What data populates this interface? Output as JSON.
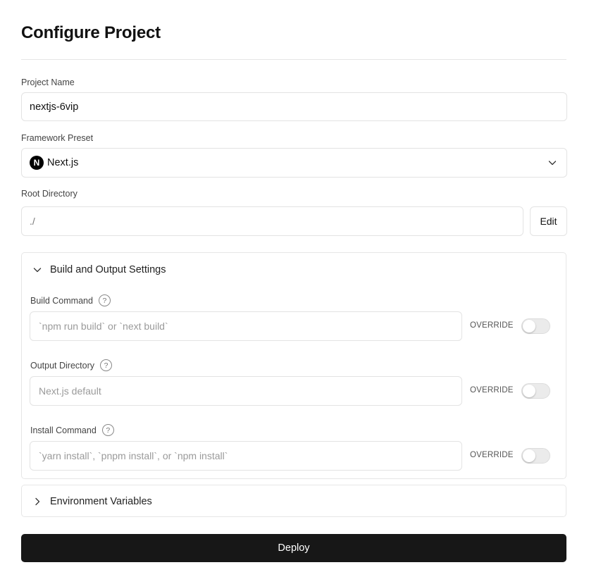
{
  "page": {
    "title": "Configure Project"
  },
  "project_name": {
    "label": "Project Name",
    "value": "nextjs-6vip"
  },
  "framework": {
    "label": "Framework Preset",
    "logo_letter": "N",
    "value": "Next.js",
    "icon": "chevron-down-icon"
  },
  "root_directory": {
    "label": "Root Directory",
    "value": "./",
    "edit_label": "Edit"
  },
  "build_settings": {
    "title": "Build and Output Settings",
    "expanded": true,
    "fields": [
      {
        "label": "Build Command",
        "help": "?",
        "placeholder": "`npm run build` or `next build`",
        "override_label": "OVERRIDE",
        "override_enabled": false
      },
      {
        "label": "Output Directory",
        "help": "?",
        "placeholder": "Next.js default",
        "override_label": "OVERRIDE",
        "override_enabled": false
      },
      {
        "label": "Install Command",
        "help": "?",
        "placeholder": "`yarn install`, `pnpm install`, or `npm install`",
        "override_label": "OVERRIDE",
        "override_enabled": false
      }
    ]
  },
  "env_vars": {
    "title": "Environment Variables",
    "expanded": false
  },
  "deploy": {
    "label": "Deploy"
  },
  "colors": {
    "primary_button": "#171717",
    "border": "#e3e3e3",
    "toggle_off": "#ebebeb"
  }
}
